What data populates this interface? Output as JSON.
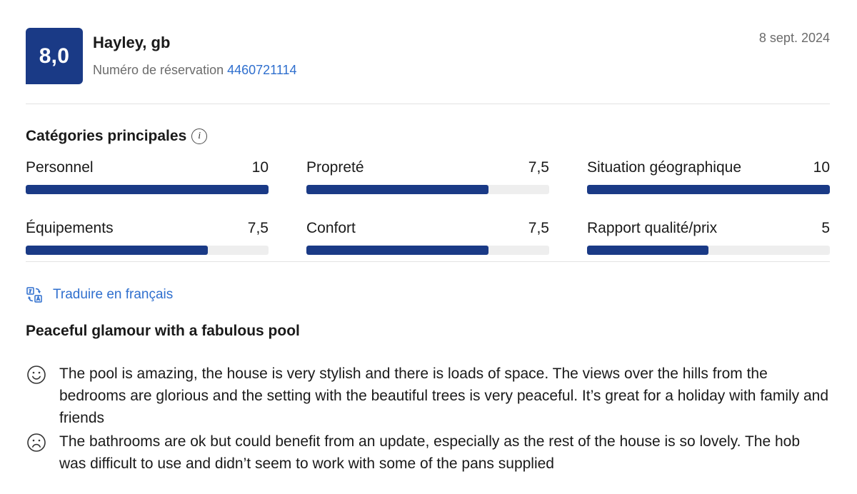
{
  "review": {
    "score": "8,0",
    "reviewer": "Hayley, gb",
    "booking_label": "Numéro de réservation",
    "booking_number": "4460721114",
    "date": "8 sept. 2024"
  },
  "categories": {
    "title": "Catégories principales",
    "items": [
      {
        "label": "Personnel",
        "value": "10",
        "fraction": 1.0
      },
      {
        "label": "Propreté",
        "value": "7,5",
        "fraction": 0.75
      },
      {
        "label": "Situation géographique",
        "value": "10",
        "fraction": 1.0
      },
      {
        "label": "Équipements",
        "value": "7,5",
        "fraction": 0.75
      },
      {
        "label": "Confort",
        "value": "7,5",
        "fraction": 0.75
      },
      {
        "label": "Rapport qualité/prix",
        "value": "5",
        "fraction": 0.5
      }
    ]
  },
  "translate": {
    "label": "Traduire en français"
  },
  "content": {
    "title": "Peaceful glamour with a fabulous pool",
    "positive": "The pool is amazing, the house is very stylish and there is loads of space. The views over the hills from the bedrooms are glorious and the setting with the beautiful trees is very peaceful. It’s great for a holiday with family and friends",
    "negative": "The bathrooms are ok but could benefit from an update, especially as the rest of the house is so lovely. The hob was difficult to use and didn’t seem to work with some of the pans supplied"
  },
  "colors": {
    "brand": "#1a3a86",
    "link": "#2f6fce",
    "muted": "#6b6b6b",
    "track": "#eeeeee"
  },
  "icons": {
    "info": "info-icon",
    "translate": "translate-icon",
    "positive": "smiley-face-icon",
    "negative": "sad-face-icon"
  }
}
